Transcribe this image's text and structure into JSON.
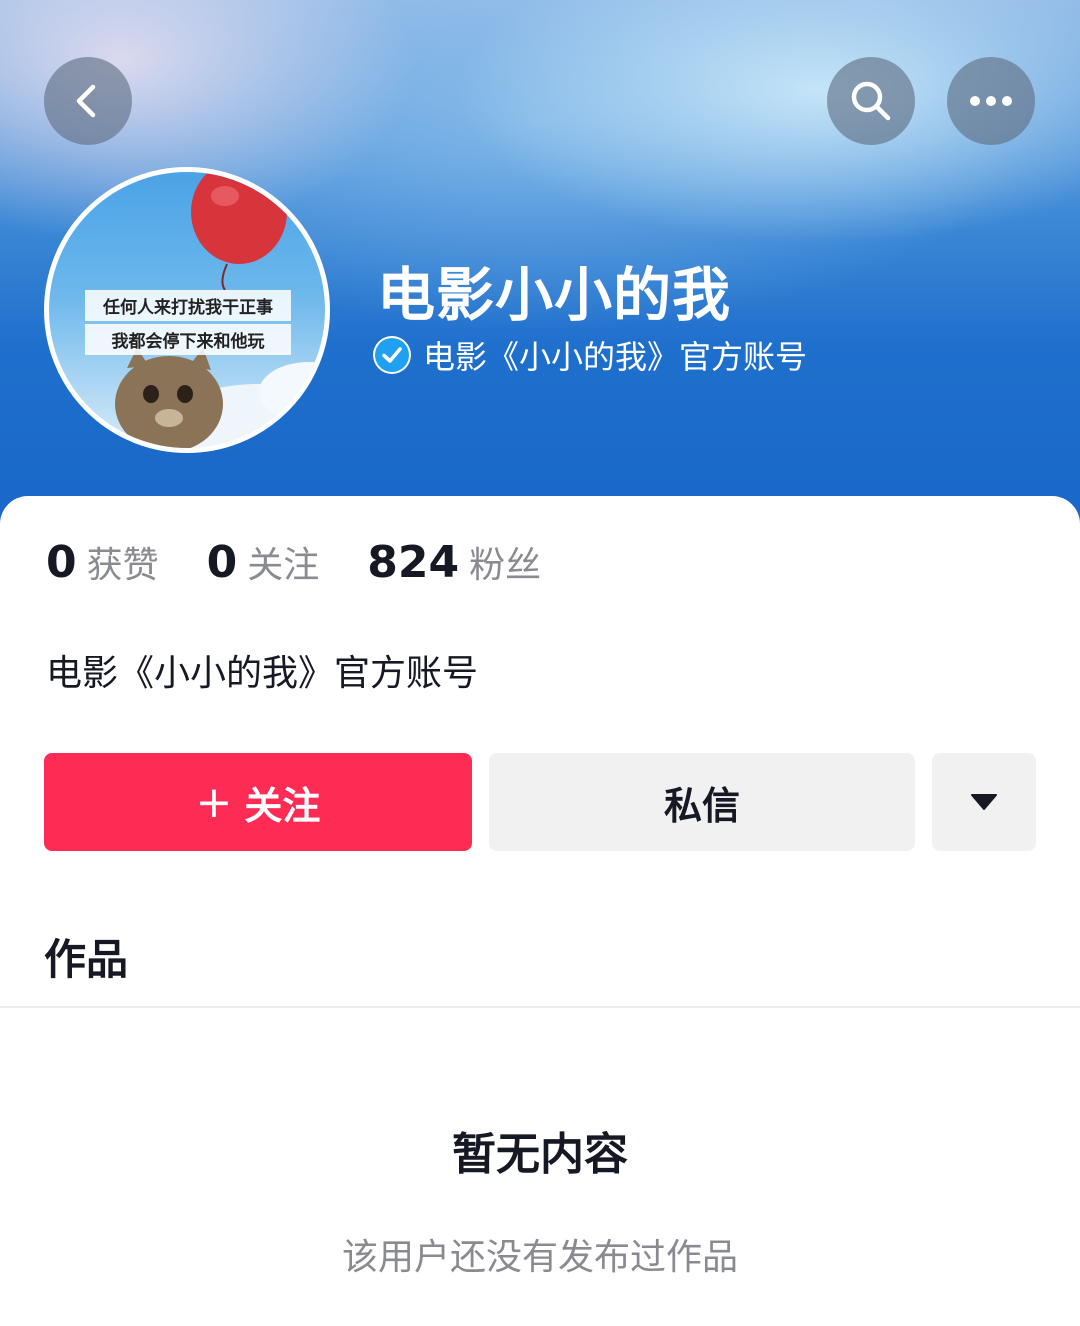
{
  "header": {
    "back_icon": "chevron-left-icon",
    "search_icon": "search-icon",
    "more_icon": "more-horizontal-icon"
  },
  "profile": {
    "avatar_caption_line1": "任何人来打扰我干正事",
    "avatar_caption_line2": "我都会停下来和他玩",
    "name": "电影小小的我",
    "verified_label": "电影《小小的我》官方账号",
    "bio": "电影《小小的我》官方账号"
  },
  "stats": [
    {
      "value": "0",
      "label": "获赞"
    },
    {
      "value": "0",
      "label": "关注"
    },
    {
      "value": "824",
      "label": "粉丝"
    }
  ],
  "actions": {
    "follow_plus": "+",
    "follow_label": "关注",
    "message_label": "私信",
    "dropdown_icon": "caret-down-icon"
  },
  "works": {
    "section_title": "作品",
    "empty_title": "暂无内容",
    "empty_subtitle": "该用户还没有发布过作品"
  },
  "colors": {
    "accent": "#fe2c55",
    "verified": "#20a0f0",
    "secondary_button": "#f1f1f2"
  }
}
